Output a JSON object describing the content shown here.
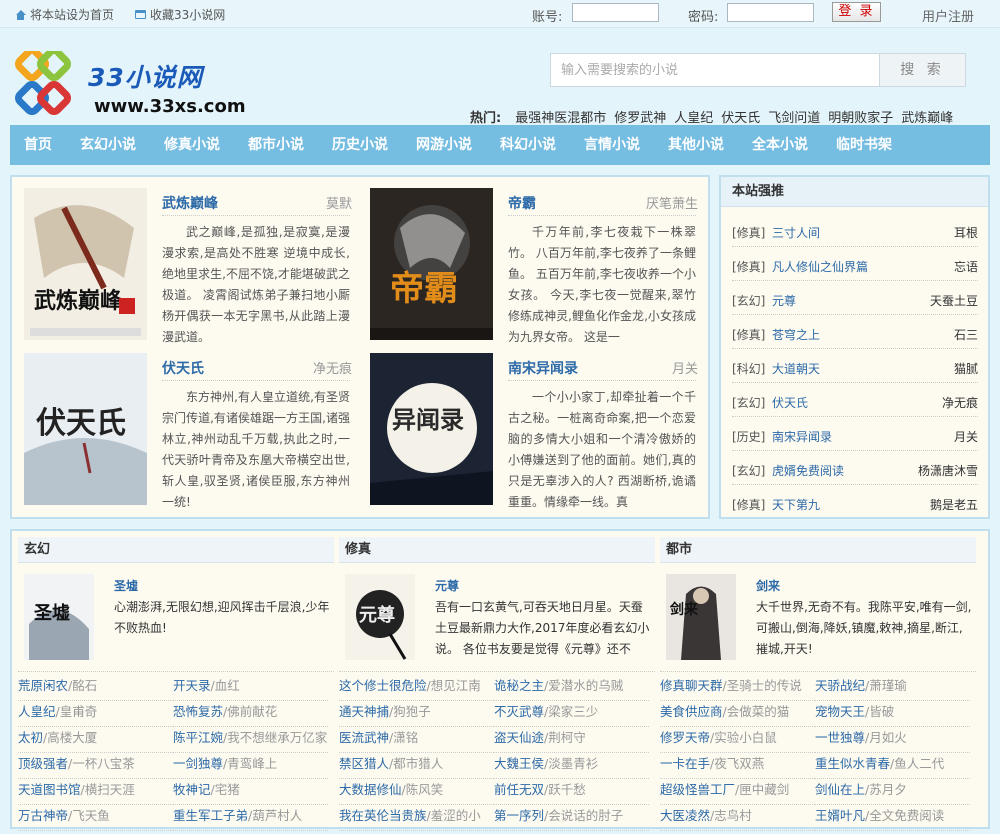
{
  "topbar": {
    "set_home": "将本站设为首页",
    "bookmark": "收藏33小说网",
    "account_label": "账号:",
    "password_label": "密码:",
    "login_button": "登 录",
    "register": "用户注册"
  },
  "header": {
    "logo_text": "33小说网",
    "logo_url": "www.33xs.com",
    "search_placeholder": "输入需要搜索的小说",
    "search_button": "搜 索",
    "hot_label": "热门:",
    "hot_links": [
      "最强神医混都市",
      "修罗武神",
      "人皇纪",
      "伏天氏",
      "飞剑问道",
      "明朝败家子",
      "武炼巅峰"
    ]
  },
  "nav": [
    "首页",
    "玄幻小说",
    "修真小说",
    "都市小说",
    "历史小说",
    "网游小说",
    "科幻小说",
    "言情小说",
    "其他小说",
    "全本小说",
    "临时书架"
  ],
  "featured": [
    {
      "title": "武炼巅峰",
      "author": "莫默",
      "desc": "武之巅峰,是孤独,是寂寞,是漫漫求索,是高处不胜寒 逆境中成长,绝地里求生,不屈不饶,才能堪破武之极道。 凌霄阁试炼弟子兼扫地小厮杨开偶获一本无字黑书,从此踏上漫漫武道。"
    },
    {
      "title": "帝霸",
      "author": "厌笔萧生",
      "desc": "千万年前,李七夜栽下一株翠竹。 八百万年前,李七夜养了一条鲤鱼。 五百万年前,李七夜收养一个小女孩。 今天,李七夜一觉醒来,翠竹修练成神灵,鲤鱼化作金龙,小女孩成为九界女帝。 这是一"
    },
    {
      "title": "伏天氏",
      "author": "净无痕",
      "desc": "东方神州,有人皇立道统,有圣贤宗门传道,有诸侯雄踞一方王国,诸强林立,神州动乱千万载,执此之时,一代天骄叶青帝及东凰大帝横空出世,斩人皇,驭圣贤,诸侯臣服,东方神州一统!"
    },
    {
      "title": "南宋异闻录",
      "author": "月关",
      "desc": "一个小小家丁,却牵扯着一个千古之秘。一桩离奇命案,把一个恋爱脑的多情大小姐和一个清冷傲娇的小傅嫌送到了他的面前。她们,真的只是无辜涉入的人? 西湖断桥,诡谲重重。情缘牵一线。真"
    }
  ],
  "recommend": {
    "heading": "本站强推",
    "items": [
      {
        "cat": "[修真]",
        "name": "三寸人间",
        "author": "耳根"
      },
      {
        "cat": "[修真]",
        "name": "凡人修仙之仙界篇",
        "author": "忘语"
      },
      {
        "cat": "[玄幻]",
        "name": "元尊",
        "author": "天蚕土豆"
      },
      {
        "cat": "[修真]",
        "name": "苍穹之上",
        "author": "石三"
      },
      {
        "cat": "[科幻]",
        "name": "大道朝天",
        "author": "猫腻"
      },
      {
        "cat": "[玄幻]",
        "name": "伏天氏",
        "author": "净无痕"
      },
      {
        "cat": "[历史]",
        "name": "南宋异闻录",
        "author": "月关"
      },
      {
        "cat": "[玄幻]",
        "name": "虎婿免费阅读",
        "author": "杨潇唐沐雪"
      },
      {
        "cat": "[修真]",
        "name": "天下第九",
        "author": "鹅是老五"
      }
    ]
  },
  "categories": [
    {
      "heading": "玄幻",
      "book_title": "圣墟",
      "book_desc": "心潮澎湃,无限幻想,迎风挥击千层浪,少年不败热血!",
      "list": [
        {
          "t": "荒原闲农",
          "s": "/酩石"
        },
        {
          "t": "开天录",
          "s": "/血红"
        },
        {
          "t": "人皇纪",
          "s": "/皇甫奇"
        },
        {
          "t": "恐怖复苏",
          "s": "/佛前献花"
        },
        {
          "t": "太初",
          "s": "/高楼大厦"
        },
        {
          "t": "陈平江婉",
          "s": "/我不想继承万亿家"
        },
        {
          "t": "顶级强者",
          "s": "/一杯八宝茶"
        },
        {
          "t": "一剑独尊",
          "s": "/青鸾峰上"
        },
        {
          "t": "天道图书馆",
          "s": "/横扫天涯"
        },
        {
          "t": "牧神记",
          "s": "/宅猪"
        },
        {
          "t": "万古神帝",
          "s": "/飞天鱼"
        },
        {
          "t": "重生军工子弟",
          "s": "/葫芦村人"
        }
      ]
    },
    {
      "heading": "修真",
      "book_title": "元尊",
      "book_desc": "吾有一口玄黄气,可吞天地日月星。天蚕土豆最新鼎力大作,2017年度必看玄幻小说。 各位书友要是觉得《元尊》还不",
      "list": [
        {
          "t": "这个修士很危险",
          "s": "/想见江南"
        },
        {
          "t": "诡秘之主",
          "s": "/爱潜水的乌贼"
        },
        {
          "t": "通天神捕",
          "s": "/狗狍子"
        },
        {
          "t": "不灭武尊",
          "s": "/梁家三少"
        },
        {
          "t": "医流武神",
          "s": "/潇铭"
        },
        {
          "t": "盗天仙途",
          "s": "/荆柯守"
        },
        {
          "t": "禁区猎人",
          "s": "/都市猎人"
        },
        {
          "t": "大魏王侯",
          "s": "/淡墨青衫"
        },
        {
          "t": "大数据修仙",
          "s": "/陈风笑"
        },
        {
          "t": "前任无双",
          "s": "/跃千愁"
        },
        {
          "t": "我在英伦当贵族",
          "s": "/羞涩的小"
        },
        {
          "t": "第一序列",
          "s": "/会说话的肘子"
        }
      ]
    },
    {
      "heading": "都市",
      "book_title": "剑来",
      "book_desc": "大千世界,无奇不有。我陈平安,唯有一剑,可搬山,倒海,降妖,镇魔,敕神,摘星,断江,摧城,开天!",
      "list": [
        {
          "t": "修真聊天群",
          "s": "/圣骑士的传说"
        },
        {
          "t": "天骄战纪",
          "s": "/萧瑾瑜"
        },
        {
          "t": "美食供应商",
          "s": "/会做菜的猫"
        },
        {
          "t": "宠物天王",
          "s": "/皆破"
        },
        {
          "t": "修罗天帝",
          "s": "/实验小白鼠"
        },
        {
          "t": "一世独尊",
          "s": "/月如火"
        },
        {
          "t": "一卡在手",
          "s": "/夜飞双燕"
        },
        {
          "t": "重生似水青春",
          "s": "/鱼人二代"
        },
        {
          "t": "超级怪兽工厂",
          "s": "/匣中藏剑"
        },
        {
          "t": "剑仙在上",
          "s": "/苏月夕"
        },
        {
          "t": "大医凌然",
          "s": "/志鸟村"
        },
        {
          "t": "王婿叶凡",
          "s": "/全文免费阅读"
        }
      ]
    }
  ]
}
